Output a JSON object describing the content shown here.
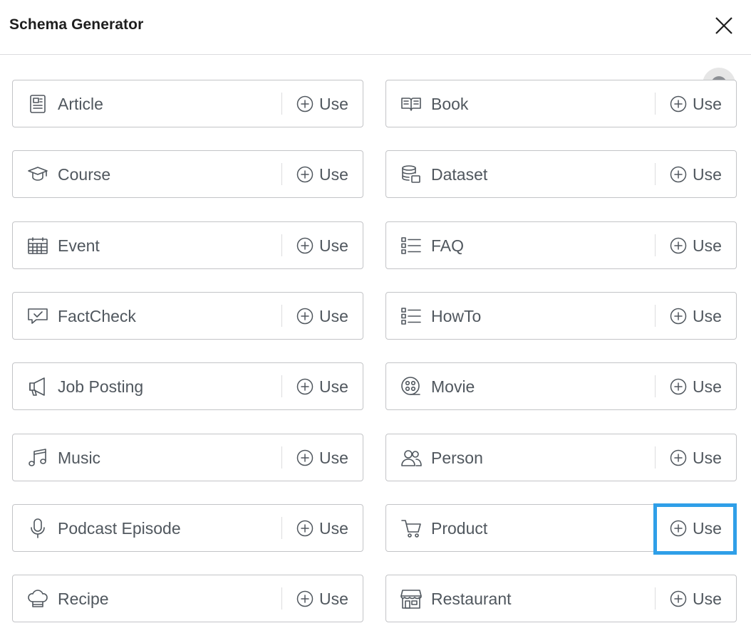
{
  "header": {
    "title": "Schema Generator",
    "close_icon": "close-icon"
  },
  "use_label": "Use",
  "items": [
    {
      "label": "Article",
      "icon": "article-icon"
    },
    {
      "label": "Book",
      "icon": "book-icon"
    },
    {
      "label": "Course",
      "icon": "graduation-cap-icon"
    },
    {
      "label": "Dataset",
      "icon": "database-icon"
    },
    {
      "label": "Event",
      "icon": "calendar-icon"
    },
    {
      "label": "FAQ",
      "icon": "list-icon"
    },
    {
      "label": "FactCheck",
      "icon": "comment-check-icon"
    },
    {
      "label": "HowTo",
      "icon": "list-icon"
    },
    {
      "label": "Job Posting",
      "icon": "megaphone-icon"
    },
    {
      "label": "Movie",
      "icon": "film-reel-icon"
    },
    {
      "label": "Music",
      "icon": "music-note-icon"
    },
    {
      "label": "Person",
      "icon": "people-icon"
    },
    {
      "label": "Podcast Episode",
      "icon": "microphone-icon"
    },
    {
      "label": "Product",
      "icon": "shopping-cart-icon"
    },
    {
      "label": "Recipe",
      "icon": "chef-hat-icon"
    },
    {
      "label": "Restaurant",
      "icon": "storefront-icon"
    }
  ],
  "highlighted_item": "Product",
  "colors": {
    "highlight": "#2f9fe8",
    "border": "#c3c4c7",
    "text": "#50575e"
  }
}
